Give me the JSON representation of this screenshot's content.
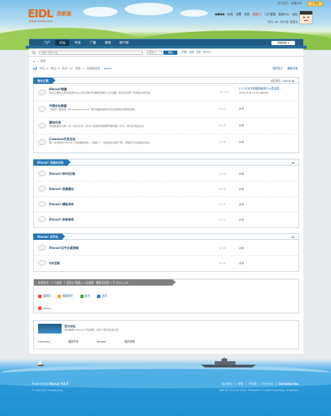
{
  "brand": {
    "logo_text": "EIDL",
    "logo_cn": "西斯道",
    "url": "www.eiodl.com"
  },
  "toplinks": [
    "设为首页",
    "收藏本站"
  ],
  "top_button": "★ 收起",
  "user": {
    "name": "admin",
    "status": "在线",
    "settings": "设置",
    "messages": "消息",
    "alerts": "提醒(1)",
    "portal": "门户管理",
    "admin": "管理中心",
    "logout": "退出"
  },
  "user_stats": {
    "credits": "积分: 86",
    "group": "用户组: 管理员"
  },
  "nav": {
    "items": [
      "门户",
      "论坛",
      "导读",
      "广播",
      "群组",
      "排行榜"
    ],
    "active_index": 1,
    "quick_nav": "快捷导航 ▾"
  },
  "search": {
    "placeholder": "请输入搜索内容",
    "type": "帖子 ▾",
    "button": "搜索",
    "hot_label": "热搜:",
    "hot": [
      "活动",
      "交友",
      "discuz"
    ]
  },
  "breadcrumb": {
    "home": "⌂",
    "forum": "论坛"
  },
  "stats": {
    "today": "今日: 0",
    "yesterday": "昨日: 0",
    "posts": "帖子: 22",
    "members": "会员: 1",
    "newest_label": "欢迎新会员:",
    "newest": "admin"
  },
  "right_links": {
    "my_posts": "我的帖子",
    "new_posts": "最新回复"
  },
  "sections": [
    {
      "title": "站长之家",
      "mod_label": "分区版主:",
      "mod": "admin",
      "forums": [
        {
          "name": "Discuz!联盟",
          "desc": "本站主要帖大家在使用Discuz!的过程中所遇到的操作上的问题，我们会在第一时间给大家答复",
          "count": "21 / 21",
          "last": "3-11日本大地震网速两千元是运营...",
          "last_sub": "2012-3-8 11:20 admin"
        },
        {
          "name": "中国论坛联盟",
          "desc": "《我站》服务商（zz.comsenz.com）是中国最有影响力的互联网创业服务机构。",
          "count": "0 / 0",
          "last": "从未",
          "last_sub": ""
        },
        {
          "name": "建站交流",
          "desc": "本板面适合大家一对一真实交流，来向广告和相关管理举报的推广行为，请勿在本板交流。",
          "count": "0 / 0",
          "last": "从未",
          "last_sub": ""
        },
        {
          "name": "Comsenz开发日志",
          "desc": "第一时间提供 Discuz! 论坛最新程序、升级补丁、特色程序免费下载，请随时关注新版本动态。",
          "count": "0 / 0",
          "last": "从未",
          "last_sub": ""
        }
      ]
    },
    {
      "title": "Discuz! 交流与讨论",
      "forums": [
        {
          "name": "Discuz!-BUG反馈",
          "count": "0 / 0",
          "last": "从未"
        },
        {
          "name": "Discuz!-发展建议",
          "count": "0 / 0",
          "last": "从未"
        },
        {
          "name": "Discuz!-模板发布",
          "count": "0 / 0",
          "last": "从未"
        },
        {
          "name": "Discuz!-安装使用",
          "count": "0 / 0",
          "last": "从未"
        }
      ]
    },
    {
      "title": "Discuz! 云平台",
      "forums": [
        {
          "name": "Discuz!云平台漫游插",
          "count": "0 / 0",
          "last": "从未"
        },
        {
          "name": "QQ互联",
          "count": "0 / 0",
          "last": "从未"
        }
      ]
    }
  ],
  "online": {
    "header": "在线会员 · 1 人在线 · 1 会员(0 隐身), 0 位游客 · 最高记录是 1 于 2012-3-8.",
    "legend": [
      "管理员",
      "超级版主",
      "版主",
      "会员"
    ],
    "legend_colors": [
      "#f04a3c",
      "#f0a43c",
      "#4ca34c",
      "#3c7ec8"
    ],
    "user": "admin"
  },
  "links": {
    "title": "官方论坛",
    "desc": "提供最新 Discuz! 产品新闻、软件下载与技术交流",
    "items": [
      "Comsenz",
      "漫游平台",
      "Yeswan",
      "我的领地"
    ]
  },
  "footer": {
    "powered_label": "Powered by",
    "powered": "Discuz! X2.5",
    "copyright": "© 2001-2012 Comsenz Inc.",
    "links": [
      "站点统计",
      "举报",
      "手机版",
      "Archiver"
    ],
    "company": "Comsenz Inc.",
    "time": "GMT+8, 2012-3-8 15:45 , Processed in 0.094953 second(s), 16 queries ."
  }
}
